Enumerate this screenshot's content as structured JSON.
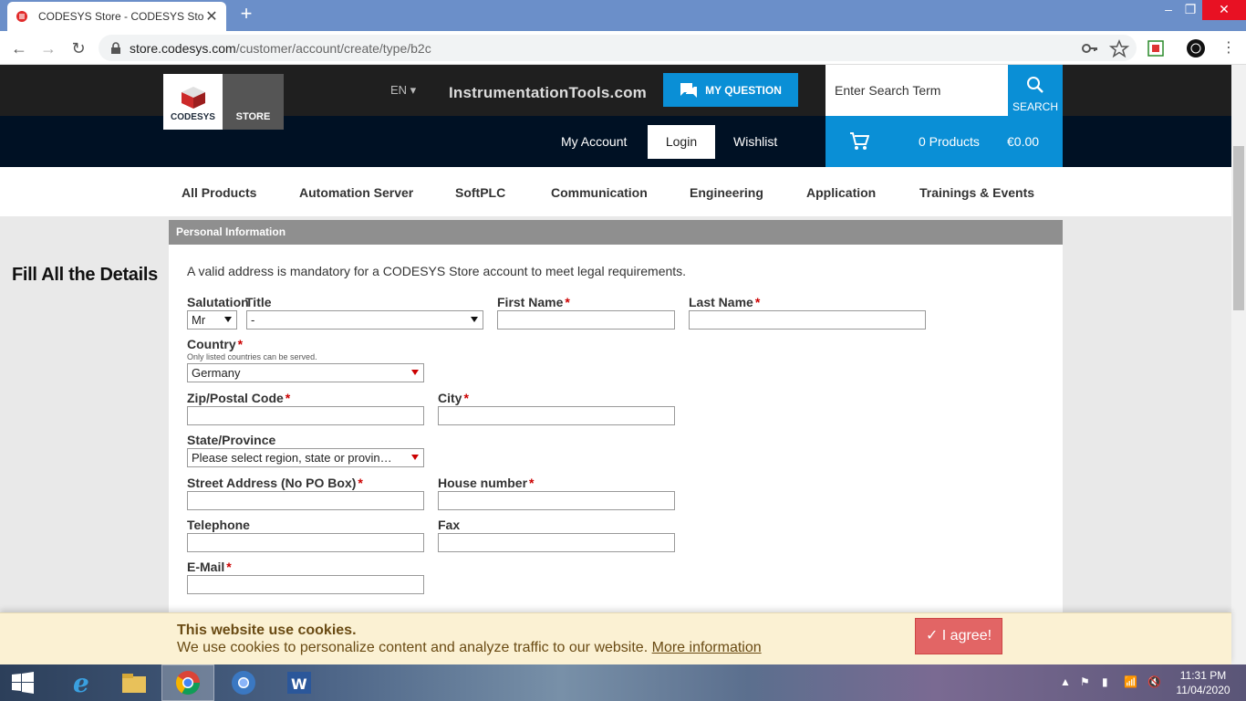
{
  "browser": {
    "tab_title": "CODESYS Store - CODESYS Store",
    "url_host": "store.codesys.com",
    "url_path": "/customer/account/create/type/b2c"
  },
  "header": {
    "logo_text": "CODESYS",
    "logo_store": "STORE",
    "lang": "EN ▾",
    "watermark": "InstrumentationTools.com",
    "my_question": "MY QUESTION",
    "search_placeholder": "Enter Search Term",
    "search_label": "SEARCH",
    "my_account": "My Account",
    "login": "Login",
    "wishlist": "Wishlist",
    "cart_products": "0 Products",
    "cart_total": "€0.00"
  },
  "categories": [
    "All Products",
    "Automation Server",
    "SoftPLC",
    "Communication",
    "Engineering",
    "Application",
    "Trainings & Events"
  ],
  "side_heading": "Fill All the Details",
  "form": {
    "section_title": "Personal Information",
    "notice": "A valid address is mandatory for a CODESYS Store account to meet legal requirements.",
    "salutation_label": "Salutation",
    "salutation_value": "Mr",
    "title_label": "Title",
    "title_value": "-",
    "first_name_label": "First Name",
    "last_name_label": "Last Name",
    "country_label": "Country",
    "country_hint": "Only listed countries can be served.",
    "country_value": "Germany",
    "zip_label": "Zip/Postal Code",
    "city_label": "City",
    "state_label": "State/Province",
    "state_value": "Please select region, state or provin…",
    "street_label": "Street Address (No PO Box)",
    "house_label": "House number",
    "telephone_label": "Telephone",
    "fax_label": "Fax",
    "email_label": "E-Mail",
    "required_mark": "*"
  },
  "cookie": {
    "heading": "This website use cookies.",
    "message": "We use cookies to personalize content and analyze traffic to our website.",
    "link": "More information",
    "agree": "✓ I agree!"
  },
  "taskbar": {
    "time": "11:31 PM",
    "date": "11/04/2020"
  }
}
